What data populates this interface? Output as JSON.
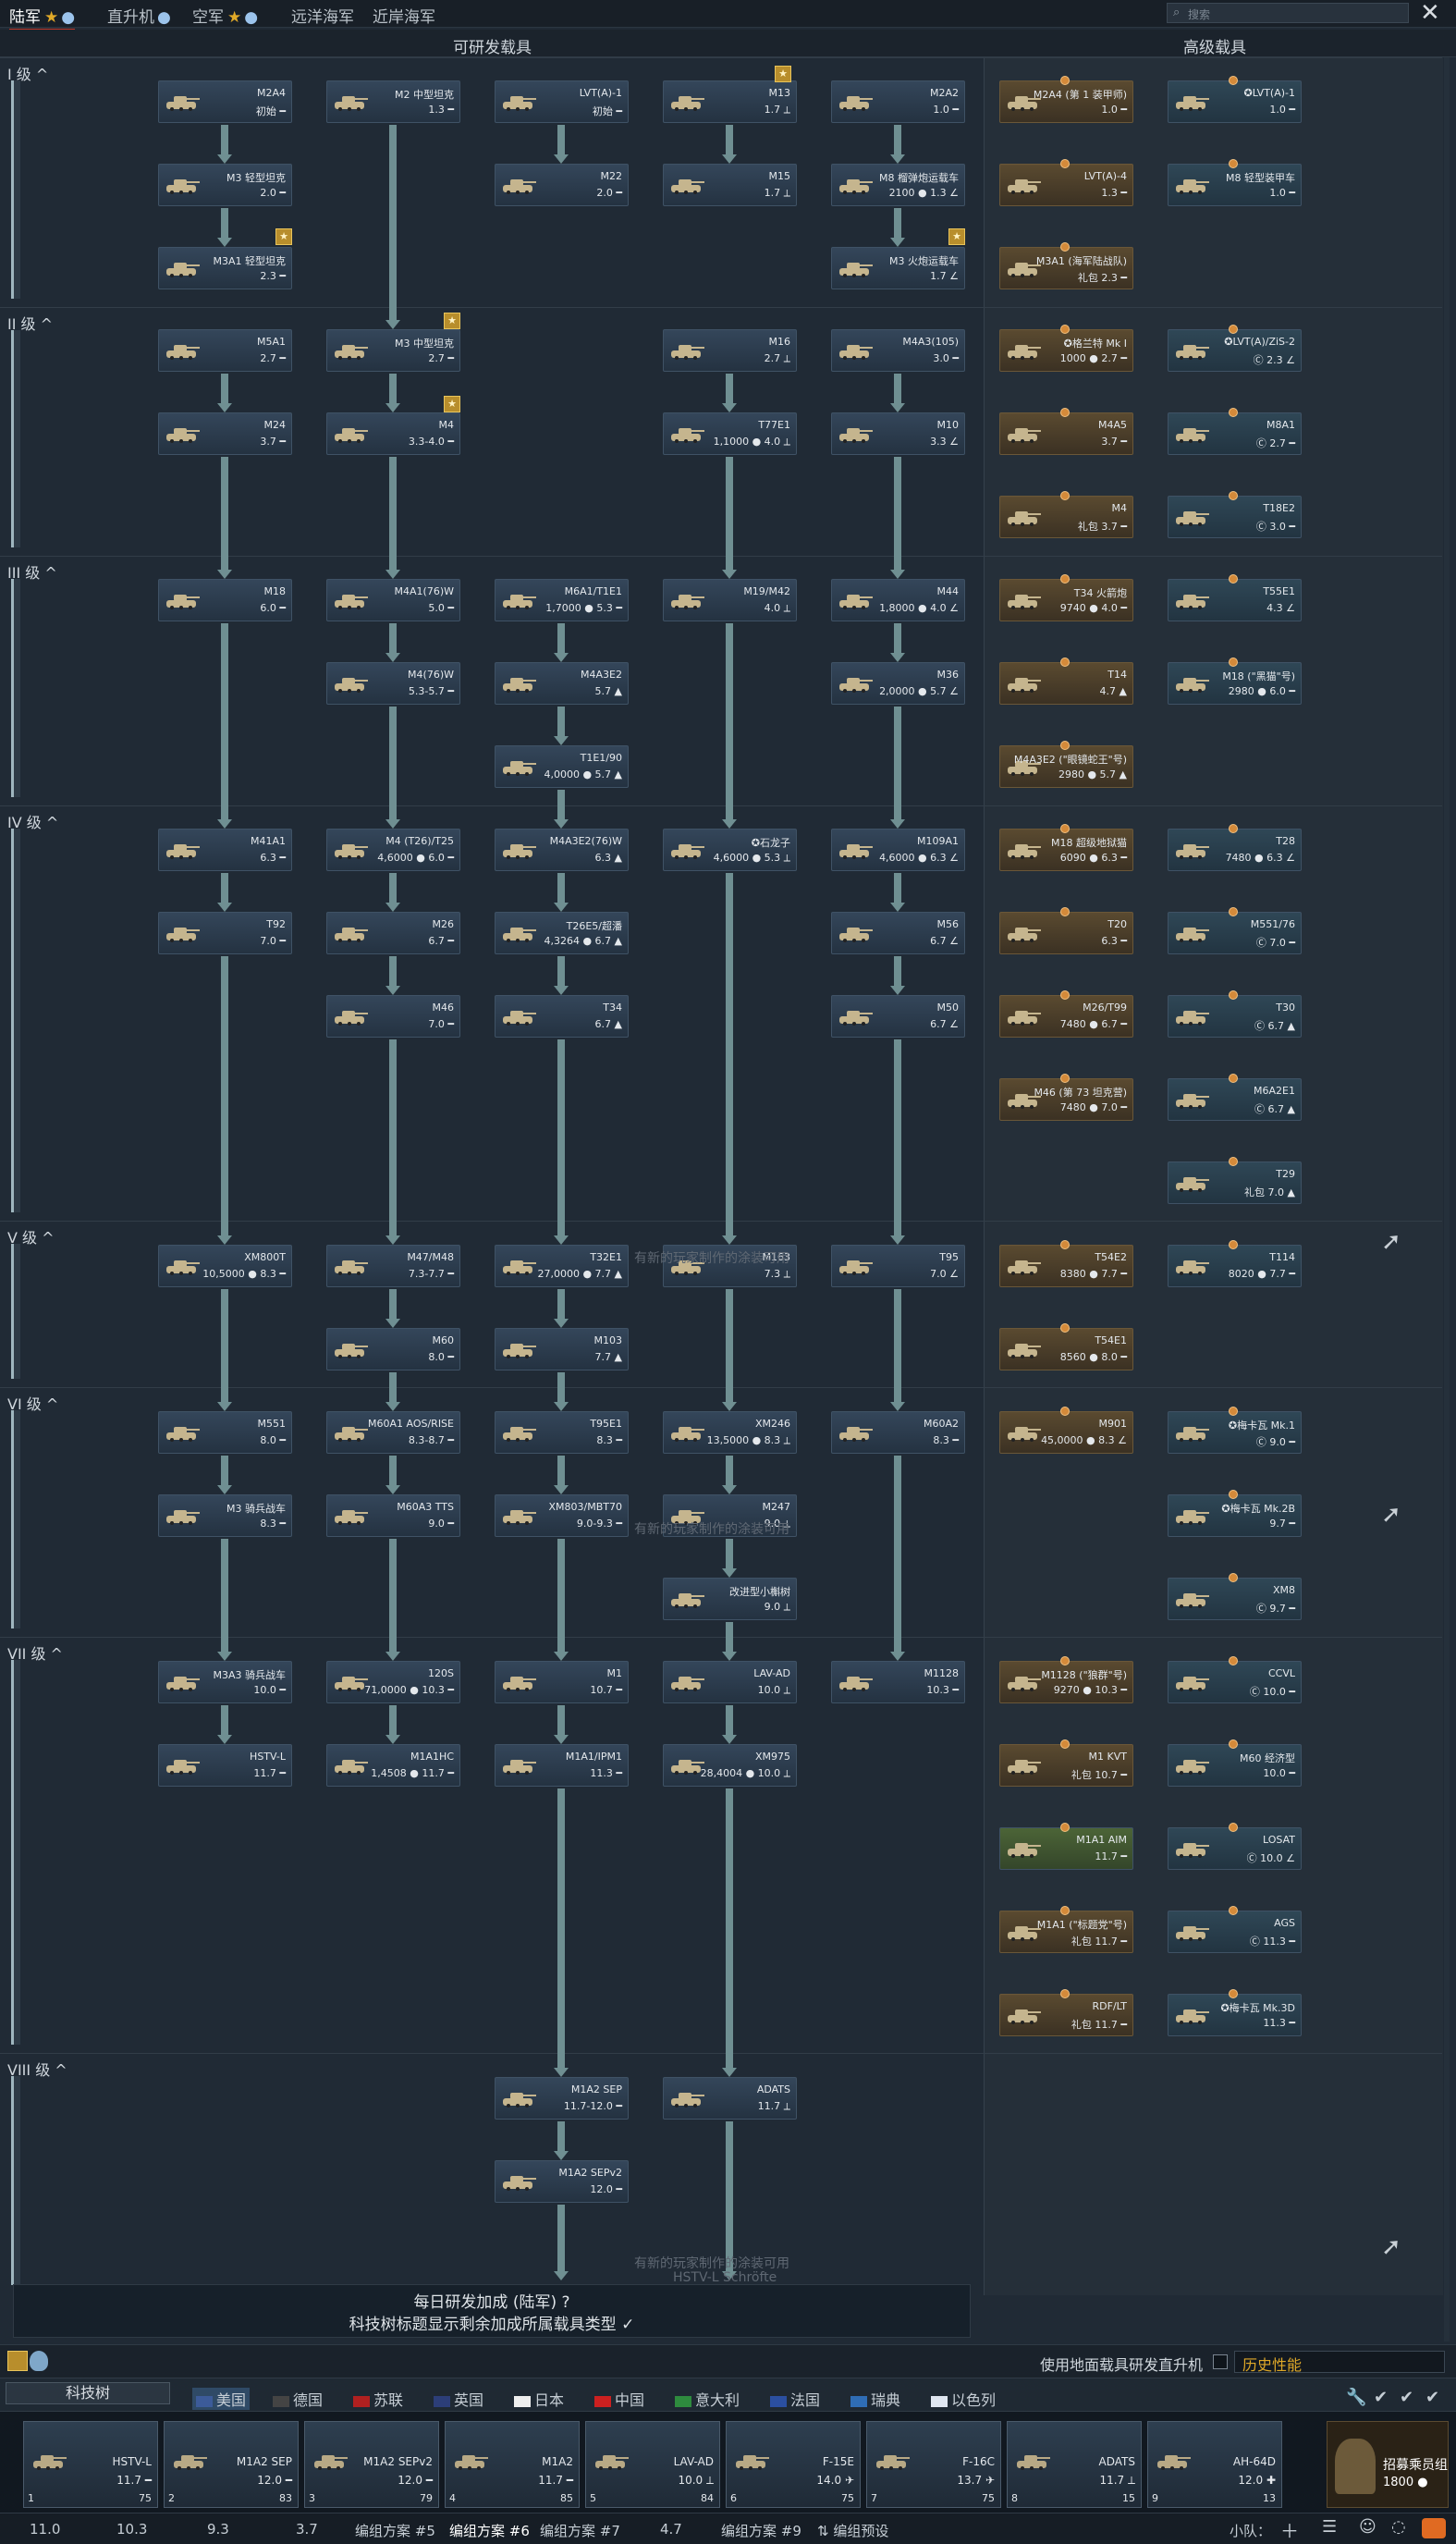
{
  "topbar": {
    "tabs": [
      {
        "label": "陆军",
        "star": "★",
        "bulb": "💡",
        "active": true
      },
      {
        "label": "直升机",
        "bulb": "💡"
      },
      {
        "label": "空军",
        "star": "★",
        "bulb": "💡"
      },
      {
        "label": "远洋海军"
      },
      {
        "label": "近岸海军"
      }
    ],
    "search_placeholder": "搜索",
    "close": "✕"
  },
  "columns": {
    "researchable": "可研发载具",
    "premium": "高级载具"
  },
  "tiers": [
    "I 级 ^",
    "II 级 ^",
    "III 级 ^",
    "IV 级 ^",
    "V 级 ^",
    "VI 级 ^",
    "VII 级 ^",
    "VIII 级 ^"
  ],
  "cards": [
    {
      "name": "M2A4",
      "br": "初始 ━"
    },
    {
      "name": "M2 中型坦克",
      "br": "1.3 ━"
    },
    {
      "name": "LVT(A)-1",
      "br": "初始 ━"
    },
    {
      "name": "M13",
      "br": "1.7 ⟂"
    },
    {
      "name": "M2A2",
      "br": "1.0 ━"
    },
    {
      "name": "M3 轻型坦克",
      "br": "2.0 ━"
    },
    {
      "name": "M22",
      "br": "2.0 ━"
    },
    {
      "name": "M15",
      "br": "1.7 ⟂"
    },
    {
      "name": "M8 榴弹炮运载车",
      "br": "2100 ● 1.3 ∠"
    },
    {
      "name": "M3A1 轻型坦克",
      "br": "2.3 ━"
    },
    {
      "name": "M3 火炮运载车",
      "br": "1.7 ∠"
    },
    {
      "name": "M5A1",
      "br": "2.7 ━"
    },
    {
      "name": "M3 中型坦克",
      "br": "2.7 ━"
    },
    {
      "name": "M16",
      "br": "2.7 ⟂"
    },
    {
      "name": "M4A3(105)",
      "br": "3.0 ━"
    },
    {
      "name": "M24",
      "br": "3.7 ━"
    },
    {
      "name": "M4",
      "br": "3.3-4.0 ━"
    },
    {
      "name": "T77E1",
      "br": "1,1000 ● 4.0 ⟂"
    },
    {
      "name": "M10",
      "br": "3.3 ∠"
    },
    {
      "name": "M18",
      "br": "6.0 ━"
    },
    {
      "name": "M4A1(76)W",
      "br": "5.0 ━"
    },
    {
      "name": "M6A1/T1E1",
      "br": "1,7000 ● 5.3 ━"
    },
    {
      "name": "M19/M42",
      "br": "4.0 ⟂"
    },
    {
      "name": "M44",
      "br": "1,8000 ● 4.0 ∠"
    },
    {
      "name": "M4(76)W",
      "br": "5.3-5.7 ━"
    },
    {
      "name": "M4A3E2",
      "br": "5.7 ▲"
    },
    {
      "name": "M36",
      "br": "2,0000 ● 5.7 ∠"
    },
    {
      "name": "T1E1/90",
      "br": "4,0000 ● 5.7 ▲"
    },
    {
      "name": "M41A1",
      "br": "6.3 ━"
    },
    {
      "name": "M4 (T26)/T25",
      "br": "4,6000 ● 6.0 ━"
    },
    {
      "name": "M4A3E2(76)W",
      "br": "6.3 ▲"
    },
    {
      "name": "✪石龙子",
      "br": "4,6000 ● 5.3 ⟂"
    },
    {
      "name": "M109A1",
      "br": "4,6000 ● 6.3 ∠"
    },
    {
      "name": "T92",
      "br": "7.0 ━"
    },
    {
      "name": "M26",
      "br": "6.7 ━"
    },
    {
      "name": "T26E5/超潘",
      "br": "4,3264 ● 6.7 ▲"
    },
    {
      "name": "M56",
      "br": "6.7 ∠"
    },
    {
      "name": "M46",
      "br": "7.0 ━"
    },
    {
      "name": "T34",
      "br": "6.7 ▲"
    },
    {
      "name": "M50",
      "br": "6.7 ∠"
    },
    {
      "name": "XM800T",
      "br": "10,5000 ● 8.3 ━"
    },
    {
      "name": "M47/M48",
      "br": "7.3-7.7 ━"
    },
    {
      "name": "T32E1",
      "br": "27,0000 ● 7.7 ▲"
    },
    {
      "name": "M163",
      "br": "7.3 ⟂"
    },
    {
      "name": "T95",
      "br": "7.0 ∠"
    },
    {
      "name": "M60",
      "br": "8.0 ━"
    },
    {
      "name": "M103",
      "br": "7.7 ▲"
    },
    {
      "name": "M551",
      "br": "8.0 ━"
    },
    {
      "name": "M60A1 AOS/RISE",
      "br": "8.3-8.7 ━"
    },
    {
      "name": "T95E1",
      "br": "8.3 ━"
    },
    {
      "name": "XM246",
      "br": "13,5000 ● 8.3 ⟂"
    },
    {
      "name": "M60A2",
      "br": "8.3 ━"
    },
    {
      "name": "M3 骑兵战车",
      "br": "8.3 ━"
    },
    {
      "name": "M60A3 TTS",
      "br": "9.0 ━"
    },
    {
      "name": "XM803/MBT70",
      "br": "9.0-9.3 ━"
    },
    {
      "name": "M247",
      "br": "9.0 ⟂"
    },
    {
      "name": "改进型小槲树",
      "br": "9.0 ⟂"
    },
    {
      "name": "M3A3 骑兵战车",
      "br": "10.0 ━"
    },
    {
      "name": "120S",
      "br": "71,0000 ● 10.3 ━"
    },
    {
      "name": "M1",
      "br": "10.7 ━"
    },
    {
      "name": "LAV-AD",
      "br": "10.0 ⟂"
    },
    {
      "name": "M1128",
      "br": "10.3 ━"
    },
    {
      "name": "HSTV-L",
      "br": "11.7 ━"
    },
    {
      "name": "M1A1HC",
      "br": "1,4508 ● 11.7 ━"
    },
    {
      "name": "M1A1/IPM1",
      "br": "11.3 ━"
    },
    {
      "name": "XM975",
      "br": "28,4004 ● 10.0 ⟂"
    },
    {
      "name": "M1A2 SEP",
      "br": "11.7-12.0 ━"
    },
    {
      "name": "ADATS",
      "br": "11.7 ⟂"
    },
    {
      "name": "M1A2 SEPv2",
      "br": "12.0 ━"
    }
  ],
  "premium_cards": [
    {
      "name": "M2A4 (第 1 装甲师)",
      "br": "1.0 ━"
    },
    {
      "name": "✪LVT(A)-1",
      "br": "1.0 ━"
    },
    {
      "name": "LVT(A)-4",
      "br": "1.3 ━"
    },
    {
      "name": "M8 轻型装甲车",
      "br": "1.0 ━"
    },
    {
      "name": "M3A1 (海军陆战队)",
      "br": "礼包 2.3 ━"
    },
    {
      "name": "✪格兰特 Mk I",
      "br": "1000 ● 2.7 ━"
    },
    {
      "name": "✪LVT(A)/ZiS-2",
      "br": "Ⓒ 2.3 ∠"
    },
    {
      "name": "M4A5",
      "br": "3.7 ━"
    },
    {
      "name": "M8A1",
      "br": "Ⓒ 2.7 ━"
    },
    {
      "name": "M4",
      "br": "礼包 3.7 ━"
    },
    {
      "name": "T18E2",
      "br": "Ⓒ 3.0 ━"
    },
    {
      "name": "T34 火箭炮",
      "br": "9740 ● 4.0 ━"
    },
    {
      "name": "T55E1",
      "br": "4.3 ∠"
    },
    {
      "name": "T14",
      "br": "4.7 ▲"
    },
    {
      "name": "M18 (\"黑猫\"号)",
      "br": "2980 ● 6.0 ━"
    },
    {
      "name": "M4A3E2 (\"眼镜蛇王\"号)",
      "br": "2980 ● 5.7 ▲"
    },
    {
      "name": "M18 超级地狱猫",
      "br": "6090 ● 6.3 ━"
    },
    {
      "name": "T28",
      "br": "7480 ● 6.3 ∠"
    },
    {
      "name": "T20",
      "br": "6.3 ━"
    },
    {
      "name": "M551/76",
      "br": "Ⓒ 7.0 ━"
    },
    {
      "name": "M26/T99",
      "br": "7480 ● 6.7 ━"
    },
    {
      "name": "T30",
      "br": "Ⓒ 6.7 ▲"
    },
    {
      "name": "M46 (第 73 坦克营)",
      "br": "7480 ● 7.0 ━"
    },
    {
      "name": "M6A2E1",
      "br": "Ⓒ 6.7 ▲"
    },
    {
      "name": "T29",
      "br": "礼包 7.0 ▲"
    },
    {
      "name": "T54E2",
      "br": "8380 ● 7.7 ━"
    },
    {
      "name": "T114",
      "br": "8020 ● 7.7 ━"
    },
    {
      "name": "T54E1",
      "br": "8560 ● 8.0 ━"
    },
    {
      "name": "M901",
      "br": "45,0000 ● 8.3 ∠"
    },
    {
      "name": "✪梅卡瓦 Mk.1",
      "br": "Ⓒ 9.0 ━"
    },
    {
      "name": "✪梅卡瓦 Mk.2B",
      "br": "9.7 ━"
    },
    {
      "name": "XM8",
      "br": "Ⓒ 9.7 ━"
    },
    {
      "name": "M1128 (\"狼群\"号)",
      "br": "9270 ● 10.3 ━"
    },
    {
      "name": "CCVL",
      "br": "Ⓒ 10.0 ━"
    },
    {
      "name": "M1 KVT",
      "br": "礼包 10.7 ━"
    },
    {
      "name": "M60 经济型",
      "br": "10.0 ━"
    },
    {
      "name": "M1A1 AIM",
      "br": "11.7 ━"
    },
    {
      "name": "LOSAT",
      "br": "Ⓒ 10.0 ∠"
    },
    {
      "name": "M1A1 (\"标题党\"号)",
      "br": "礼包 11.7 ━"
    },
    {
      "name": "AGS",
      "br": "Ⓒ 11.3 ━"
    },
    {
      "name": "RDF/LT",
      "br": "礼包 11.7 ━"
    },
    {
      "name": "✪梅卡瓦 Mk.3D",
      "br": "11.3 ━"
    }
  ],
  "ghost_texts": [
    "有新的玩家制作的涂装可用",
    "有新的玩家制作的涂装可用",
    "有新的玩家制作的涂装可用",
    "HSTV-L Schröfte"
  ],
  "bottom_note": {
    "title": "每日研发加成 (陆军) ?",
    "subtitle": "科技树标题显示剩余加成所属载具类型 ✓"
  },
  "history": {
    "label": "使用地面载具研发直升机",
    "select": "历史性能"
  },
  "nation_selector": "科技树",
  "nations": [
    {
      "label": "美国",
      "color": "#3c5b99",
      "active": true
    },
    {
      "label": "德国",
      "color": "#444"
    },
    {
      "label": "苏联",
      "color": "#b02020"
    },
    {
      "label": "英国",
      "color": "#2c3e78"
    },
    {
      "label": "日本",
      "color": "#eeeeee"
    },
    {
      "label": "中国",
      "color": "#cc2020"
    },
    {
      "label": "意大利",
      "color": "#2e8b3e"
    },
    {
      "label": "法国",
      "color": "#2b4fa0"
    },
    {
      "label": "瑞典",
      "color": "#2f6db5"
    },
    {
      "label": "以色列",
      "color": "#dfe6f0"
    }
  ],
  "crew": [
    {
      "name": "HSTV-L",
      "br": "11.7 ━",
      "num": "1",
      "pts": "75"
    },
    {
      "name": "M1A2 SEP",
      "br": "12.0 ━",
      "num": "2",
      "pts": "83"
    },
    {
      "name": "M1A2 SEPv2",
      "br": "12.0 ━",
      "num": "3",
      "pts": "79"
    },
    {
      "name": "M1A2",
      "br": "11.7 ━",
      "num": "4",
      "pts": "85"
    },
    {
      "name": "LAV-AD",
      "br": "10.0 ⟂",
      "num": "5",
      "pts": "84"
    },
    {
      "name": "F-15E",
      "br": "14.0 ✈",
      "num": "6",
      "pts": "75"
    },
    {
      "name": "F-16C",
      "br": "13.7 ✈",
      "num": "7",
      "pts": "75"
    },
    {
      "name": "ADATS",
      "br": "11.7 ⟂",
      "num": "8",
      "pts": "15"
    },
    {
      "name": "AH-64D",
      "br": "12.0 ✚",
      "num": "9",
      "pts": "13"
    }
  ],
  "recruit": {
    "label": "招募乘员组",
    "price": "1800 ●"
  },
  "presets": [
    {
      "label": "11.0"
    },
    {
      "label": "10.3"
    },
    {
      "label": "9.3"
    },
    {
      "label": "3.7"
    },
    {
      "label": "编组方案 #5"
    },
    {
      "label": "编组方案 #6",
      "active": true
    },
    {
      "label": "编组方案 #7"
    },
    {
      "label": "4.7"
    },
    {
      "label": "编组方案 #9"
    },
    {
      "label": "⇅ 编组预设"
    }
  ],
  "squad_label": "小队：",
  "icons": [
    "wrench-icon",
    "check-icon",
    "mail-icon"
  ]
}
